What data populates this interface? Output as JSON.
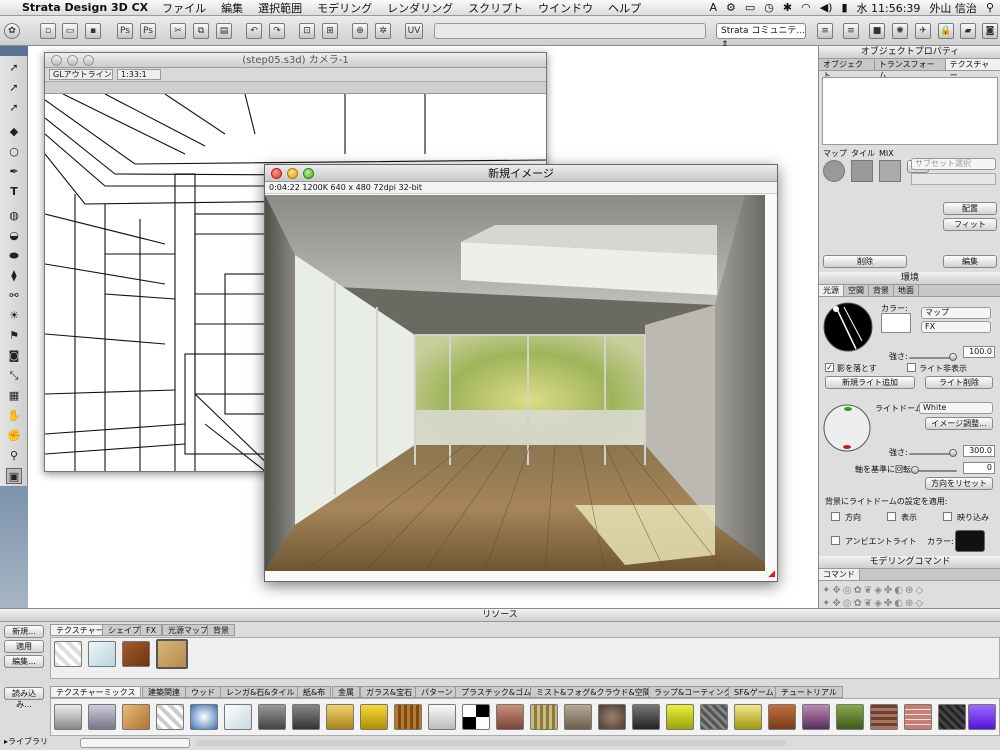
{
  "menubar": {
    "app_name": "Strata Design 3D CX",
    "items": [
      "ファイル",
      "編集",
      "選択範囲",
      "モデリング",
      "レンダリング",
      "スクリプト",
      "ウインドウ",
      "ヘルプ"
    ],
    "clock": "水 11:56:39",
    "user": "外山 信治"
  },
  "toolbar": {
    "community_label": "Strata コミュニテ..."
  },
  "camera_window": {
    "title": "(step05.s3d) カメラ-1",
    "render_mode": "GLアウトライン",
    "zoom": "1:33:1"
  },
  "render_window": {
    "title": "新規イメージ",
    "info": "0:04:22   1200K   640 x 480   72dpi   32-bit"
  },
  "object_properties": {
    "title": "オブジェクトプロパティ",
    "tabs": [
      "オブジェクト",
      "トランスフォーム",
      "テクスチャー"
    ],
    "labels": {
      "map": "マップ",
      "tile": "タイル",
      "mix": "MIX"
    },
    "swap_label": "交換",
    "surface_select": "サブセット選択",
    "btn_place": "配置",
    "btn_fit": "フィット",
    "btn_delete": "削除",
    "btn_edit": "編集"
  },
  "environment": {
    "title": "環境",
    "tabs": [
      "光源",
      "空間",
      "背景",
      "地面"
    ],
    "color_label": "カラー:",
    "map_popup": "マップ",
    "fx_popup": "FX",
    "intensity_label": "強さ:",
    "intensity_value": "100.0",
    "shadow_label": "影を落とす",
    "show_light_label": "ライト非表示",
    "new_light_btn": "新規ライト追加",
    "delete_light_btn": "ライト削除",
    "light_dome_label": "ライトドーム:",
    "light_dome_value": "White",
    "image_adjust_btn": "イメージ調整...",
    "dome_intensity_value": "300.0",
    "rotate_label": "軸を基準に回転:",
    "rotate_value": "0",
    "reset_dir_btn": "方向をリセット",
    "apply_label": "背景にライトドームの設定を適用:",
    "apply_options": [
      "方向",
      "表示",
      "映り込み"
    ],
    "ambient_label": "アンビエントライト",
    "ambient_color_label": "カラー:",
    "ambient_color": "#111111"
  },
  "modeling_commands": {
    "title": "モデリングコマンド",
    "tab": "コマンド"
  },
  "resources": {
    "title": "リソース",
    "side_buttons": [
      "新規...",
      "適用",
      "編集...",
      "読み込み..."
    ],
    "top_tabs": [
      "テクスチャー",
      "シェイプ",
      "FX",
      "光源マップ",
      "背景"
    ],
    "library_tabs": [
      "テクスチャーミックス",
      "建築関連",
      "ウッド",
      "レンガ&石&タイル",
      "紙&布",
      "金属",
      "ガラス&宝石",
      "パターン",
      "プラスチック&ゴム",
      "ミスト&フォグ&クラウド&空間",
      "ラップ&コーティング",
      "SF&ゲーム",
      "チュートリアル"
    ],
    "library_label": "▸ライブラリ"
  }
}
